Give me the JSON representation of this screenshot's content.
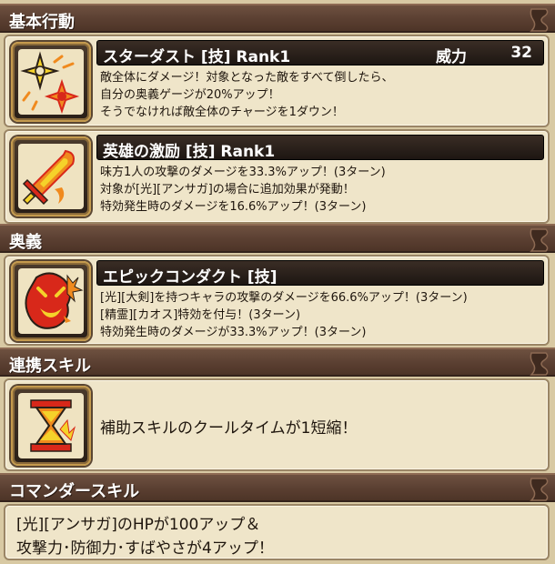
{
  "sections": {
    "basic": {
      "title": "基本行動"
    },
    "ougi": {
      "title": "奥義"
    },
    "renkei": {
      "title": "連携スキル"
    },
    "commander": {
      "title": "コマンダースキル"
    }
  },
  "skills": [
    {
      "name": "スターダスト [技]  Rank1",
      "power_label": "威力",
      "power_value": "32",
      "icon": "stardust-shuriken-icon",
      "lines": [
        "敵全体にダメージ！対象となった敵をすべて倒したら、",
        "自分の奥義ゲージが20%アップ！",
        "そうでなければ敵全体のチャージを1ダウン！"
      ]
    },
    {
      "name": "英雄の激励 [技]  Rank1",
      "icon": "flaming-sword-icon",
      "lines": [
        "味方1人の攻撃のダメージを33.3%アップ！(3ターン)",
        "対象が[光][アンサガ]の場合に追加効果が発動！",
        "特効発生時のダメージを16.6%アップ！(3ターン)"
      ]
    }
  ],
  "ougi": {
    "name": "エピックコンダクト [技]",
    "icon": "demon-burst-icon",
    "lines": [
      "[光][大剣]を持つキャラの攻撃のダメージを66.6%アップ！(3ターン)",
      "[精霊][カオス]特効を付与！(3ターン)",
      "特効発生時のダメージが33.3%アップ！(3ターン)"
    ]
  },
  "renkei": {
    "icon": "hourglass-icon",
    "text": "補助スキルのクールタイムが1短縮！"
  },
  "commander": {
    "lines": [
      "[光][アンサガ]のHPが100アップ＆",
      "攻撃力･防御力･すばやさが4アップ！"
    ]
  },
  "colors": {
    "header_bg": "#5a3f31",
    "panel_bg": "#efe5c9",
    "skill_bar_bg": "#2a211b",
    "icon_orange": "#f08a1e",
    "icon_red": "#d8281a",
    "icon_yellow": "#f5d22a"
  }
}
